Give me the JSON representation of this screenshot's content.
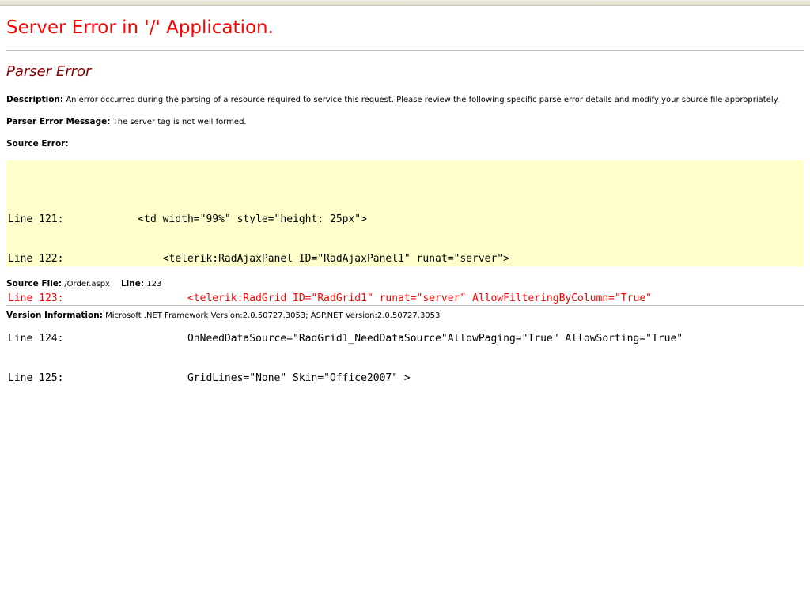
{
  "title": "Server Error in '/' Application.",
  "subtitle": "Parser Error",
  "description": {
    "label": "Description:",
    "text": "An error occurred during the parsing of a resource required to service this request. Please review the following specific parse error details and modify your source file appropriately."
  },
  "parser_error_message": {
    "label": "Parser Error Message:",
    "text": "The server tag is not well formed."
  },
  "source_error": {
    "label": "Source Error:",
    "lines": [
      {
        "text": "Line 121:            <td width=\"99%\" style=\"height: 25px\">",
        "is_error": false
      },
      {
        "text": "Line 122:                <telerik:RadAjaxPanel ID=\"RadAjaxPanel1\" runat=\"server\">",
        "is_error": false
      },
      {
        "text": "Line 123:                    <telerik:RadGrid ID=\"RadGrid1\" runat=\"server\" AllowFilteringByColumn=\"True\"",
        "is_error": true
      },
      {
        "text": "Line 124:                    OnNeedDataSource=\"RadGrid1_NeedDataSource\"AllowPaging=\"True\" AllowSorting=\"True\"",
        "is_error": false
      },
      {
        "text": "Line 125:                    GridLines=\"None\" Skin=\"Office2007\" >",
        "is_error": false
      }
    ]
  },
  "source_file": {
    "label": "Source File:",
    "value": "/Order.aspx",
    "line_label": "Line:",
    "line_value": "123"
  },
  "version_information": {
    "label": "Version Information:",
    "text": "Microsoft .NET Framework Version:2.0.50727.3053; ASP.NET Version:2.0.50727.3053"
  },
  "colors": {
    "title": "#ff0000",
    "subtitle": "#800000",
    "code_background": "#ffffcc",
    "error_line": "#ff0000",
    "rule": "#c0c0c0"
  }
}
